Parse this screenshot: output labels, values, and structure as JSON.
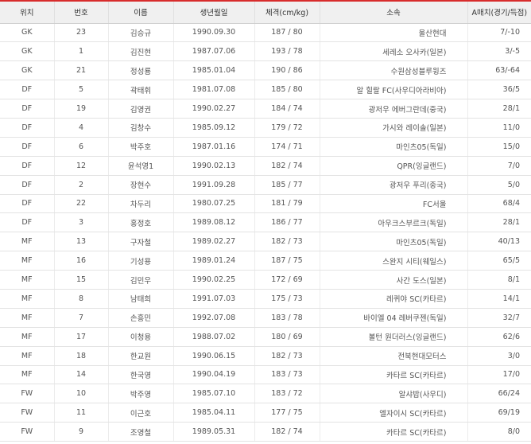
{
  "table": {
    "headers": [
      "위치",
      "번호",
      "이름",
      "생년월일",
      "체격(cm/kg)",
      "소속",
      "A매치(경기/득점)"
    ],
    "rows": [
      [
        "GK",
        "23",
        "김승규",
        "1990.09.30",
        "187 / 80",
        "울산현대",
        "7/-10"
      ],
      [
        "GK",
        "1",
        "김진현",
        "1987.07.06",
        "193 / 78",
        "세레소 오사카(일본)",
        "3/-5"
      ],
      [
        "GK",
        "21",
        "정성룡",
        "1985.01.04",
        "190 / 86",
        "수원삼성블루윙즈",
        "63/-64"
      ],
      [
        "DF",
        "5",
        "곽태휘",
        "1981.07.08",
        "185 / 80",
        "알 힐랄 FC(사우디아라비아)",
        "36/5"
      ],
      [
        "DF",
        "19",
        "김영권",
        "1990.02.27",
        "184 / 74",
        "광저우 에버그란데(중국)",
        "28/1"
      ],
      [
        "DF",
        "4",
        "김창수",
        "1985.09.12",
        "179 / 72",
        "가시와 레이솔(일본)",
        "11/0"
      ],
      [
        "DF",
        "6",
        "박주호",
        "1987.01.16",
        "174 / 71",
        "마인츠05(독일)",
        "15/0"
      ],
      [
        "DF",
        "12",
        "윤석영1",
        "1990.02.13",
        "182 / 74",
        "QPR(잉글랜드)",
        "7/0"
      ],
      [
        "DF",
        "2",
        "장현수",
        "1991.09.28",
        "185 / 77",
        "광저우 푸리(중국)",
        "5/0"
      ],
      [
        "DF",
        "22",
        "차두리",
        "1980.07.25",
        "181 / 79",
        "FC서울",
        "68/4"
      ],
      [
        "DF",
        "3",
        "홍정호",
        "1989.08.12",
        "186 / 77",
        "아우크스부르크(독일)",
        "28/1"
      ],
      [
        "MF",
        "13",
        "구자철",
        "1989.02.27",
        "182 / 73",
        "마인츠05(독일)",
        "40/13"
      ],
      [
        "MF",
        "16",
        "기성용",
        "1989.01.24",
        "187 / 75",
        "스완지 시티(웨일스)",
        "65/5"
      ],
      [
        "MF",
        "15",
        "김민우",
        "1990.02.25",
        "172 / 69",
        "사간 도스(일본)",
        "8/1"
      ],
      [
        "MF",
        "8",
        "남태희",
        "1991.07.03",
        "175 / 73",
        "레퀴야 SC(카타르)",
        "14/1"
      ],
      [
        "MF",
        "7",
        "손흥민",
        "1992.07.08",
        "183 / 78",
        "바이엘 04 레버쿠젠(독일)",
        "32/7"
      ],
      [
        "MF",
        "17",
        "이청용",
        "1988.07.02",
        "180 / 69",
        "볼턴 원더러스(잉글랜드)",
        "62/6"
      ],
      [
        "MF",
        "18",
        "한교원",
        "1990.06.15",
        "182 / 73",
        "전북현대모터스",
        "3/0"
      ],
      [
        "MF",
        "14",
        "한국영",
        "1990.04.19",
        "183 / 73",
        "카타르 SC(카타르)",
        "17/0"
      ],
      [
        "FW",
        "10",
        "박주영",
        "1985.07.10",
        "183 / 72",
        "알샤밥(사우디)",
        "66/24"
      ],
      [
        "FW",
        "11",
        "이근호",
        "1985.04.11",
        "177 / 75",
        "엘자이시 SC(카타르)",
        "69/19"
      ],
      [
        "FW",
        "9",
        "조영철",
        "1989.05.31",
        "182 / 74",
        "카타르 SC(카타르)",
        "8/0"
      ]
    ]
  },
  "colors": {
    "accent_line": "#d82c2c",
    "header_bg": "#f0f0f0",
    "row_border": "#e3e3e3",
    "text": "#555555"
  }
}
